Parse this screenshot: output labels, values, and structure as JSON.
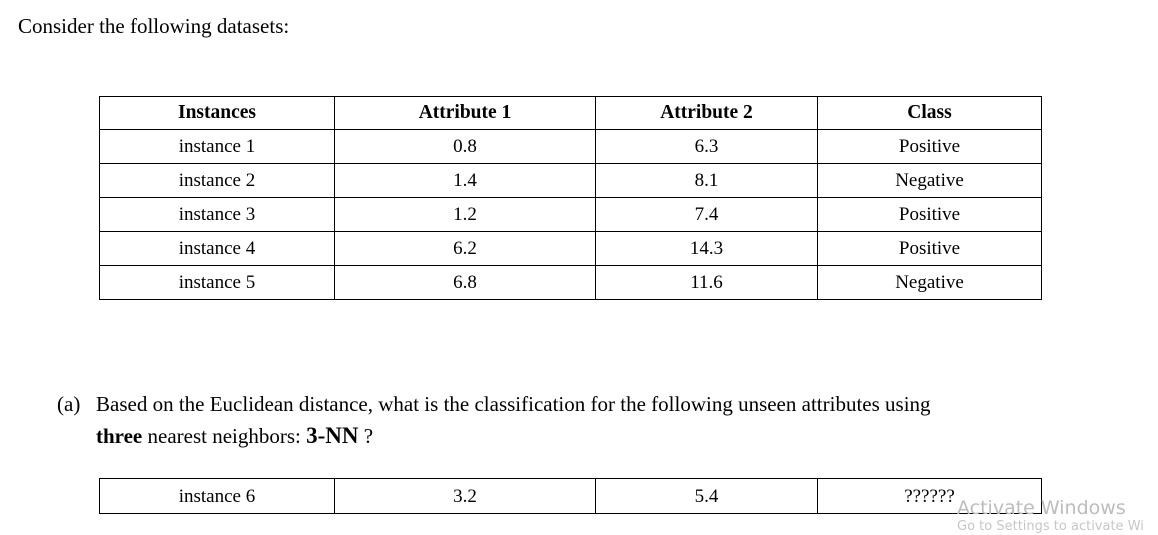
{
  "intro": {
    "text": "Consider the following datasets:"
  },
  "dataset_table": {
    "headers": [
      "Instances",
      "Attribute  1",
      "Attribute  2",
      "Class"
    ],
    "rows": [
      [
        "instance 1",
        "0.8",
        "6.3",
        "Positive"
      ],
      [
        "instance 2",
        "1.4",
        "8.1",
        "Negative"
      ],
      [
        "instance 3",
        "1.2",
        "7.4",
        "Positive"
      ],
      [
        "instance 4",
        "6.2",
        "14.3",
        "Positive"
      ],
      [
        "instance 5",
        "6.8",
        "11.6",
        "Negative"
      ]
    ]
  },
  "question": {
    "marker": "(a)",
    "line1": "Based on the Euclidean distance, what is the classification for the following unseen attributes using",
    "bold_word": "three",
    "mid_text": " nearest neighbors: ",
    "knn": "3-NN",
    "tail": " ?"
  },
  "unseen_table": {
    "row": [
      "instance 6",
      "3.2",
      "5.4",
      "??????"
    ]
  },
  "watermark": {
    "title": "Activate Windows",
    "subtitle": "Go to Settings to activate Wi"
  },
  "colors": {
    "background": "#ffffff",
    "text": "#000000",
    "border": "#000000",
    "watermark": "#bcbcbc"
  }
}
